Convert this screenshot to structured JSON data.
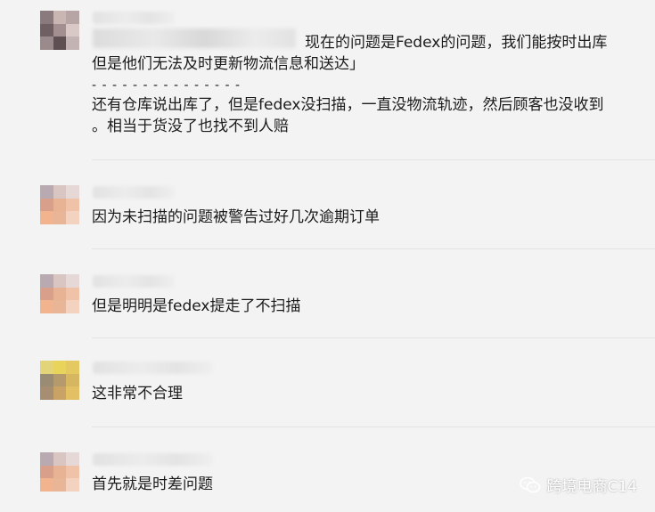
{
  "messages": [
    {
      "quote_line1": "现在的问题是Fedex的问题，我们能按时出库",
      "quote_line2": "但是他们无法及时更新物流信息和送达」",
      "separator": "- - - - - - - - - - - - - - -",
      "line1": "还有仓库说出库了，但是fedex没扫描，一直没物流轨迹，然后顾客也没收到",
      "line2": "。相当于货没了也找不到人赔"
    },
    {
      "text": "因为未扫描的问题被警告过好几次逾期订单"
    },
    {
      "text": "但是明明是fedex提走了不扫描"
    },
    {
      "text": "这非常不合理"
    },
    {
      "text": "首先就是时差问题"
    }
  ],
  "watermark": {
    "text": "跨境电商C14",
    "icon": "wechat-icon"
  },
  "colors": {
    "background": "#f3f3f3",
    "divider": "#e3e3e3",
    "text": "#1b1b1b"
  }
}
